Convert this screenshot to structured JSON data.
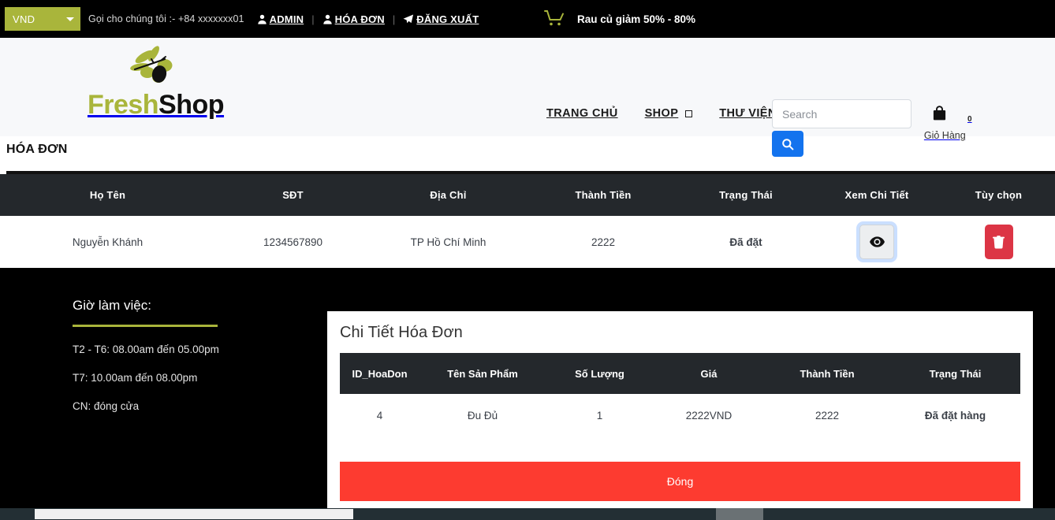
{
  "topbar": {
    "currency": "VND",
    "currency_icon": "chevron-down-icon",
    "call_us": "Gọi cho chúng tôi :- +84 xxxxxxx01",
    "links": [
      {
        "label": "ADMIN",
        "icon": "user-icon"
      },
      {
        "label": "HÓA ĐƠN",
        "icon": "user-icon"
      },
      {
        "label": "ĐĂNG XUẤT",
        "icon": "paper-plane-icon"
      }
    ],
    "separator": "|",
    "promo": {
      "icon": "shopping-cart-icon",
      "text": "Rau củ giảm 50% - 80%"
    }
  },
  "header": {
    "logo": {
      "fresh": "Fresh",
      "shop": "Shop",
      "icon": "olive-branch-icon"
    },
    "nav": [
      {
        "label": "TRANG CHỦ",
        "has_dropdown": false
      },
      {
        "label": "SHOP",
        "has_dropdown": true
      },
      {
        "label": "THƯ VIỆN",
        "has_dropdown": false
      }
    ],
    "search": {
      "placeholder": "Search",
      "value": "",
      "button_icon": "search-icon"
    },
    "cart": {
      "icon": "shopping-bag-icon",
      "count": "0",
      "label": "Giỏ Hàng"
    }
  },
  "page": {
    "title": "HÓA ĐƠN"
  },
  "invoice_table": {
    "columns": [
      "Họ Tên",
      "SĐT",
      "Địa Chỉ",
      "Thành Tiền",
      "Trạng Thái",
      "Xem Chi Tiết",
      "Tùy chọn"
    ],
    "rows": [
      {
        "ho_ten": "Nguyễn Khánh",
        "sdt": "1234567890",
        "dia_chi": "TP Hồ Chí Minh",
        "thanh_tien": "2222",
        "trang_thai": "Đã đặt",
        "view_icon": "eye-icon",
        "delete_icon": "trash-icon"
      }
    ]
  },
  "footer": {
    "hours_title": "Giờ làm việc:",
    "hours": [
      "T2 - T6: 08.00am đến 05.00pm",
      "T7: 10.00am đến 08.00pm",
      "CN: đóng cửa"
    ]
  },
  "modal": {
    "title": "Chi Tiết Hóa Đơn",
    "columns": [
      "ID_HoaDon",
      "Tên Sản Phẩm",
      "Số Lượng",
      "Giá",
      "Thành Tiền",
      "Trạng Thái"
    ],
    "rows": [
      {
        "id_hoadon": "4",
        "ten_san_pham": "Đu Đủ",
        "so_luong": "1",
        "gia": "2222VND",
        "thanh_tien": "2222",
        "trang_thai": "Đã đặt hàng"
      }
    ],
    "close_label": "Đóng"
  },
  "colors": {
    "olive": "#a9b53b",
    "dark": "#24282c",
    "blue": "#1373ee",
    "red": "#dc3545",
    "modal_red": "#fd3b30",
    "green": "#1a7a1a"
  }
}
